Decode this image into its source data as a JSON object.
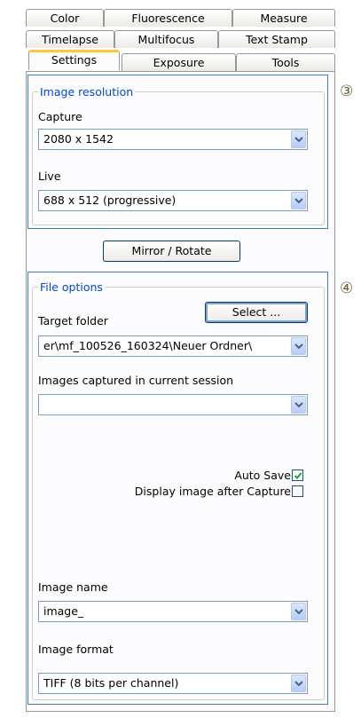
{
  "tabs": {
    "row1": [
      "Color",
      "Fluorescence",
      "Measure"
    ],
    "row2": [
      "Timelapse",
      "Multifocus",
      "Text Stamp"
    ],
    "row3": [
      "Settings",
      "Exposure",
      "Tools"
    ],
    "active": "Settings"
  },
  "image_resolution": {
    "legend": "Image resolution",
    "marker": "③",
    "capture_label": "Capture",
    "capture_value": "2080 x 1542",
    "live_label": "Live",
    "live_value": "688 x 512 (progressive)"
  },
  "mirror_rotate_label": "Mirror / Rotate",
  "file_options": {
    "legend": "File options",
    "marker": "④",
    "target_folder_label": "Target folder",
    "select_button_label": "Select ...",
    "target_folder_value": "er\\mf_100526_160324\\Neuer Ordner\\",
    "images_captured_label": "Images captured in current session",
    "images_captured_value": "",
    "auto_save_label": "Auto Save",
    "auto_save_checked": true,
    "display_after_capture_label": "Display image after Capture",
    "display_after_capture_checked": false,
    "image_name_label": "Image name",
    "image_name_value": "image_",
    "image_format_label": "Image format",
    "image_format_value": "TIFF (8 bits per channel)"
  },
  "colors": {
    "accent_border": "#3e7fc1",
    "legend_text": "#0046d5",
    "active_tab_highlight": "#ffc83c"
  }
}
